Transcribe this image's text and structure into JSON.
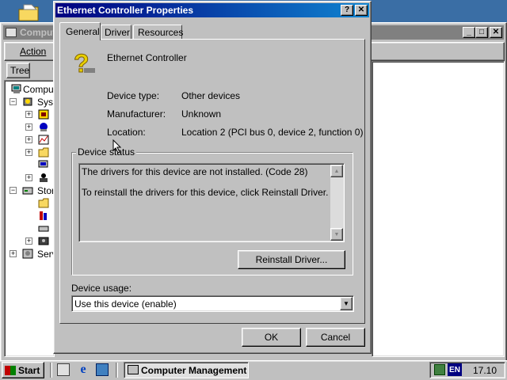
{
  "background_window": {
    "title": "Computer Management",
    "title_fragment": "Comput",
    "menu_action": "Action",
    "tab_tree": "Tree",
    "tree": {
      "root": "Comput",
      "system": "Syst",
      "storage": "Stor",
      "services": "Serv"
    }
  },
  "dialog": {
    "title": "Ethernet Controller Properties",
    "tabs": [
      "General",
      "Driver",
      "Resources"
    ],
    "device_name": "Ethernet Controller",
    "fields": {
      "type_label": "Device type:",
      "type_value": "Other devices",
      "manufacturer_label": "Manufacturer:",
      "manufacturer_value": "Unknown",
      "location_label": "Location:",
      "location_value": "Location 2 (PCI bus 0, device 2, function 0)"
    },
    "status_group": "Device status",
    "status_line1": "The drivers for this device are not installed. (Code 28)",
    "status_line2": "To reinstall the drivers for this device, click Reinstall Driver.",
    "reinstall_button": "Reinstall Driver...",
    "usage_label": "Device usage:",
    "usage_value": "Use this device (enable)",
    "ok_button": "OK",
    "cancel_button": "Cancel"
  },
  "taskbar": {
    "start": "Start",
    "task": "Computer Management",
    "lang": "EN",
    "clock": "17.10"
  }
}
